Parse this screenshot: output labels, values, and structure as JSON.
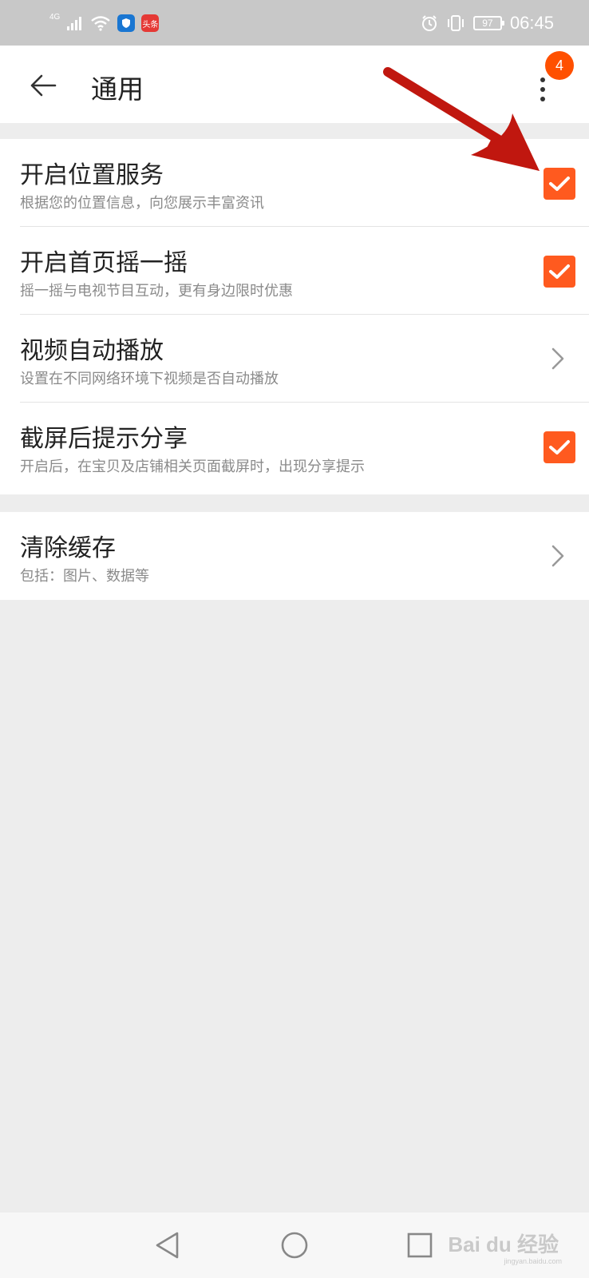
{
  "status_bar": {
    "network": "4G",
    "app_badge_1_icon": "shield-icon",
    "app_badge_2_label": "头条",
    "battery": "97",
    "time": "06:45"
  },
  "header": {
    "title": "通用",
    "notification_count": "4"
  },
  "settings": [
    {
      "title": "开启位置服务",
      "subtitle": "根据您的位置信息，向您展示丰富资讯",
      "control": "checkbox",
      "checked": true
    },
    {
      "title": "开启首页摇一摇",
      "subtitle": "摇一摇与电视节目互动，更有身边限时优惠",
      "control": "checkbox",
      "checked": true
    },
    {
      "title": "视频自动播放",
      "subtitle": "设置在不同网络环境下视频是否自动播放",
      "control": "chevron"
    },
    {
      "title": "截屏后提示分享",
      "subtitle": "开启后，在宝贝及店铺相关页面截屏时，出现分享提示",
      "control": "checkbox",
      "checked": true
    }
  ],
  "settings_2": [
    {
      "title": "清除缓存",
      "subtitle": "包括：图片、数据等",
      "control": "chevron"
    }
  ],
  "watermark": {
    "brand": "Bai du 经验",
    "url": "jingyan.baidu.com"
  },
  "colors": {
    "accent": "#ff5a1f",
    "badge": "#ff5000",
    "annotation_arrow": "#c0170f",
    "status_bar": "#c8c8c8",
    "background": "#ededed"
  }
}
